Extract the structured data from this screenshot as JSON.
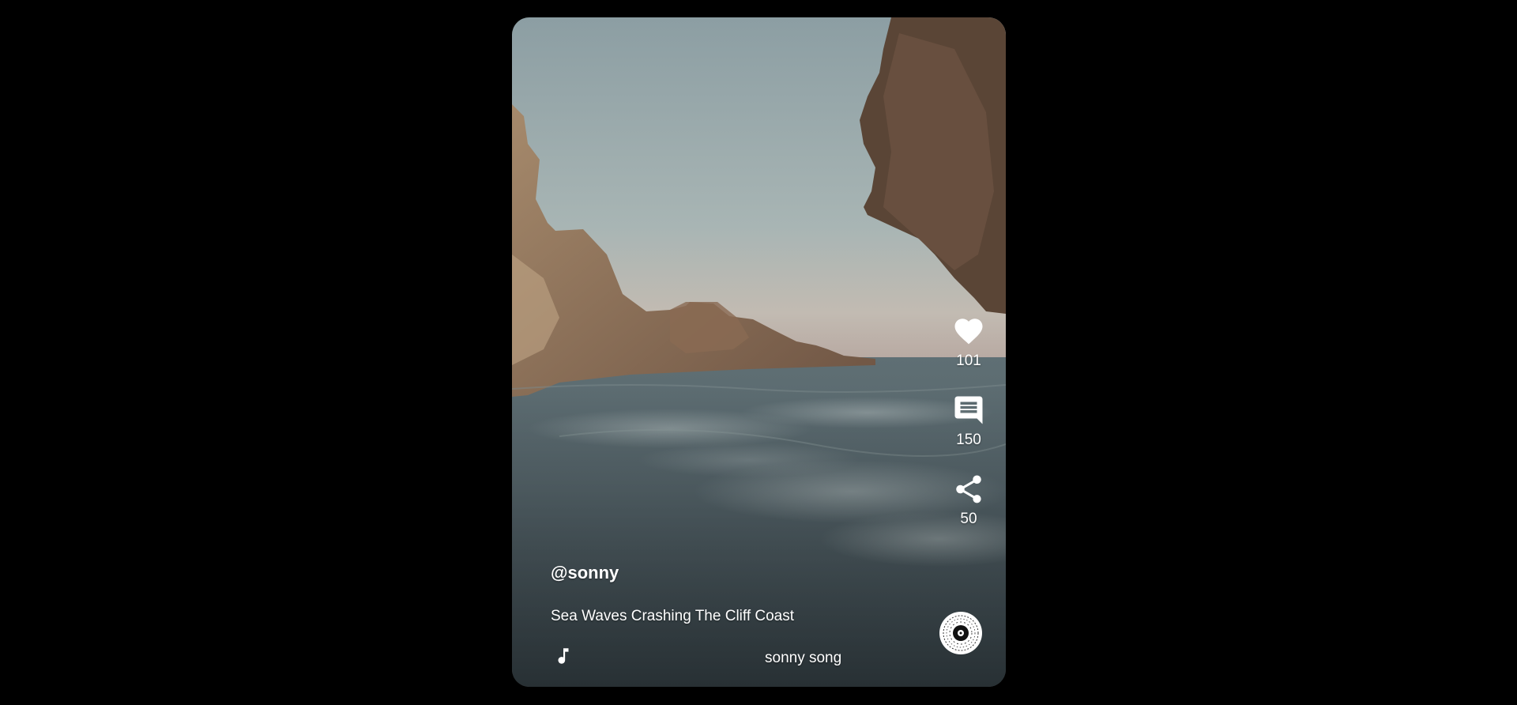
{
  "post": {
    "username": "@sonny",
    "caption": "Sea Waves Crashing The Cliff Coast",
    "song": "sonny song"
  },
  "actions": {
    "likes": "101",
    "comments": "150",
    "shares": "50"
  },
  "icons": {
    "like": "heart-icon",
    "comment": "comment-icon",
    "share": "share-icon",
    "music": "music-note-icon",
    "disc": "vinyl-disc-icon"
  }
}
